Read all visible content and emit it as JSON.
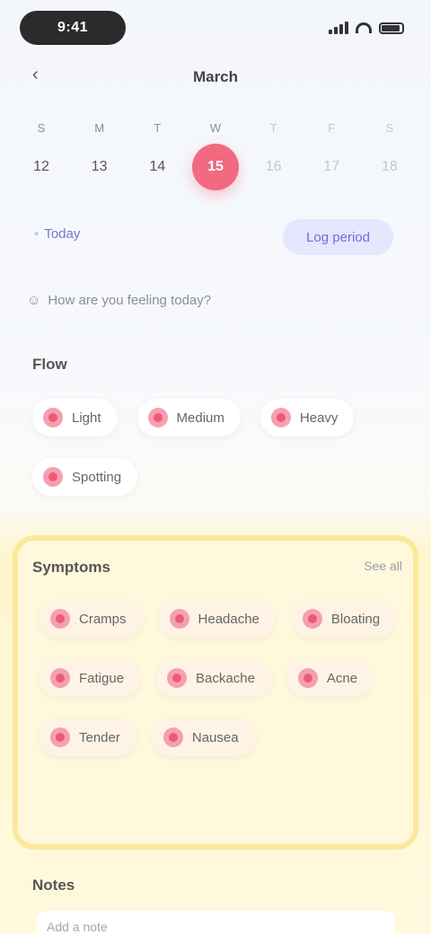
{
  "status_bar": {
    "time": "9:41"
  },
  "header": {
    "month": "March",
    "back_icon": "chevron-left-icon"
  },
  "week": [
    {
      "wd": "S",
      "num": "12",
      "state": "past"
    },
    {
      "wd": "M",
      "num": "13",
      "state": "past"
    },
    {
      "wd": "T",
      "num": "14",
      "state": "past"
    },
    {
      "wd": "W",
      "num": "15",
      "state": "selected"
    },
    {
      "wd": "T",
      "num": "16",
      "state": "future"
    },
    {
      "wd": "F",
      "num": "17",
      "state": "future"
    },
    {
      "wd": "S",
      "num": "18",
      "state": "future"
    }
  ],
  "actions": {
    "today": "Today",
    "log_button": "Log period"
  },
  "mood_line": "How are you feeling today?",
  "flow": {
    "title": "Flow",
    "chips": [
      "Light",
      "Medium",
      "Heavy",
      "Spotting"
    ]
  },
  "symptoms": {
    "title": "Symptoms",
    "see_all": "See all",
    "chips": [
      "Cramps",
      "Headache",
      "Bloating",
      "Fatigue",
      "Backache",
      "Acne",
      "Tender",
      "Nausea"
    ]
  },
  "notes": {
    "title": "Notes",
    "placeholder": "Add a note"
  },
  "colors": {
    "accent": "#f16a7f",
    "primary": "#6a6fe0",
    "card": "#fff8dc"
  }
}
